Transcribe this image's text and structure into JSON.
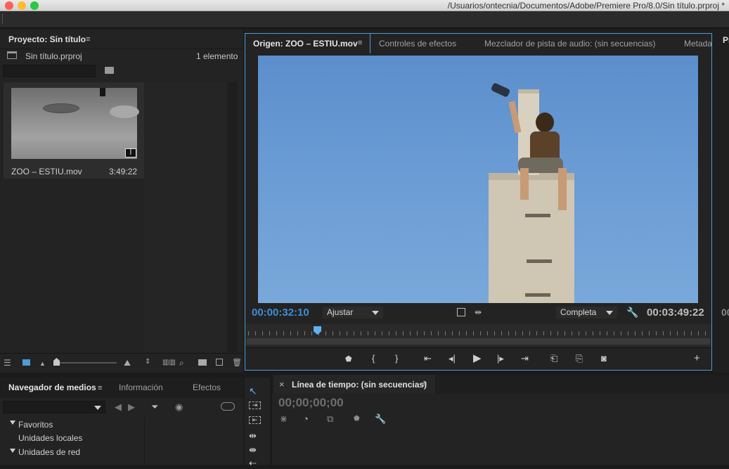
{
  "window": {
    "title": "/Usuarios/ontecnia/Documentos/Adobe/Premiere Pro/8.0/Sin título.prproj *",
    "traffic_lights": [
      "#fe5f57",
      "#febc2e",
      "#28c840"
    ]
  },
  "project_panel": {
    "tab_label": "Proyecto: Sin título",
    "menu_icon": "≡",
    "project_file": "Sin título.prproj",
    "item_count": "1 elemento",
    "clip": {
      "name": "ZOO – ESTIU.mov",
      "duration": "3:49:22",
      "badge_icon": "audio-video-icon"
    },
    "footer_icons": [
      "list-view-icon",
      "icon-view-icon",
      "zoom-out-icon",
      "zoom-slider",
      "zoom-in-icon",
      "sort-icon",
      "automate-icon",
      "find-icon",
      "new-bin-icon",
      "new-item-icon",
      "delete-icon"
    ]
  },
  "source_monitor": {
    "tabs": [
      {
        "label": "Origen: ZOO – ESTIU.mov",
        "active": true
      },
      {
        "label": "Controles de efectos",
        "active": false
      },
      {
        "label": "Mezclador de pista de audio: (sin secuencias)",
        "active": false
      },
      {
        "label": "Metada",
        "active": false
      }
    ],
    "timecode_current": "00:00:32:10",
    "fit_select": "Ajustar",
    "resolution_select": "Completa",
    "timecode_duration": "00:03:49:22",
    "accent": "#3d8fd6",
    "playhead_fraction": 0.141,
    "transport_icons": [
      "marker-icon",
      "mark-in-icon",
      "mark-out-icon",
      "go-to-in-icon",
      "step-back-icon",
      "play-icon",
      "step-forward-icon",
      "go-to-out-icon",
      "insert-icon",
      "overwrite-icon",
      "export-frame-icon",
      "add-button-icon"
    ]
  },
  "right_strip": {
    "label": "Pr",
    "timecode_fragment": "00"
  },
  "media_panel": {
    "tabs": [
      {
        "label": "Navegador de medios",
        "active": true
      },
      {
        "label": "Información",
        "active": false
      },
      {
        "label": "Efectos",
        "active": false
      }
    ],
    "tree": [
      {
        "label": "Favoritos",
        "level": 0,
        "expanded": true
      },
      {
        "label": "Unidades locales",
        "level": 1,
        "expanded": false
      },
      {
        "label": "Unidades de red",
        "level": 0,
        "expanded": true
      }
    ]
  },
  "tools": [
    "selection-tool-icon",
    "track-select-forward-icon",
    "track-select-backward-icon",
    "ripple-edit-icon",
    "rolling-edit-icon",
    "rate-stretch-icon"
  ],
  "timeline": {
    "tab_label": "Línea de tiempo: (sin secuencias)",
    "close_glyph": "×",
    "menu_icon": "≡",
    "timecode": "00;00;00;00"
  }
}
